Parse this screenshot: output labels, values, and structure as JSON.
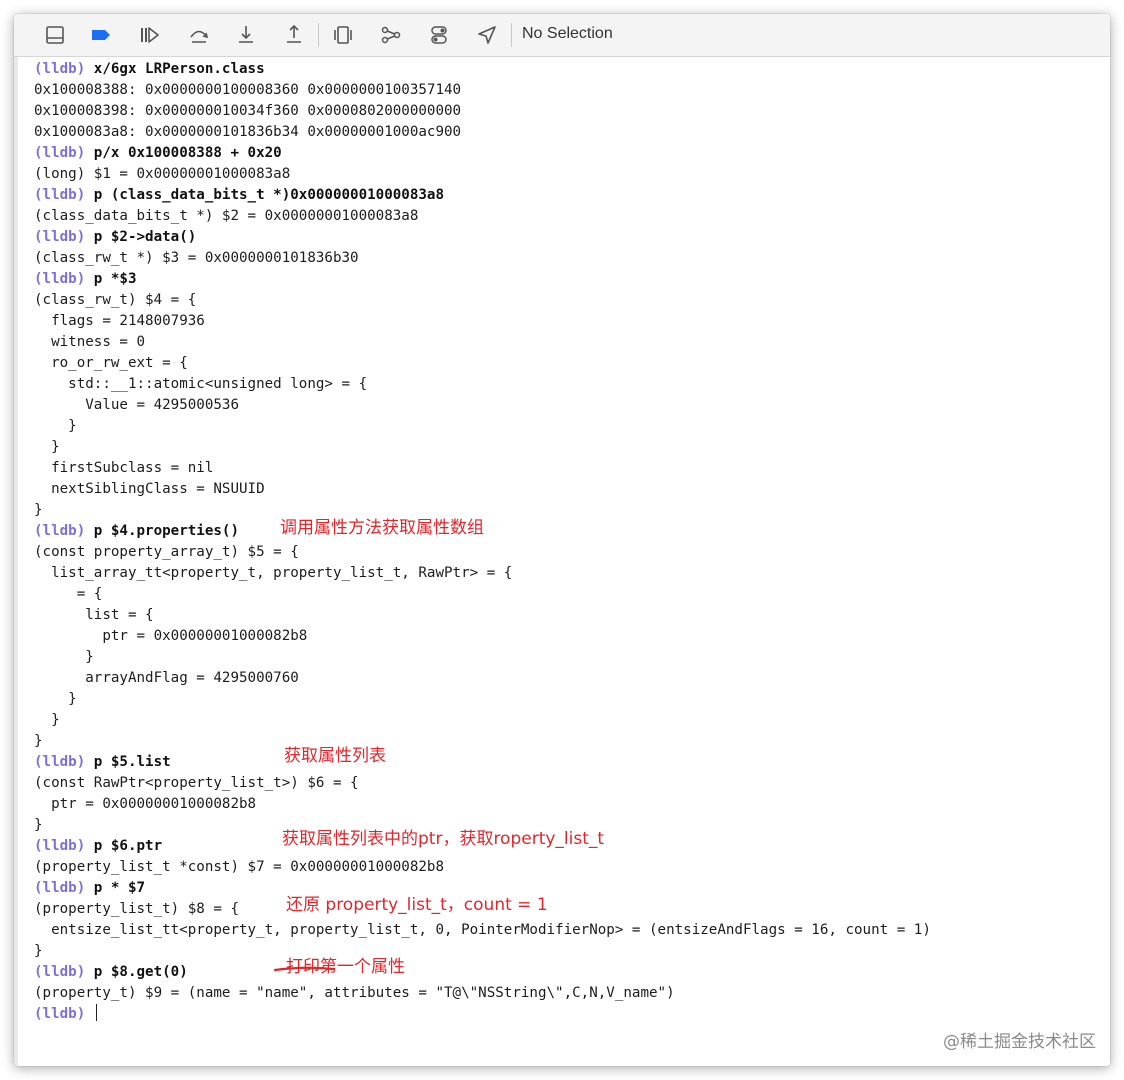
{
  "toolbar": {
    "status": "No Selection",
    "icons": [
      "hide-debug-area-icon",
      "breakpoints-toggle-icon",
      "continue-icon",
      "step-over-icon",
      "step-into-icon",
      "step-out-icon",
      "view-hierarchy-icon",
      "memory-graph-icon",
      "environment-overrides-icon",
      "simulate-location-icon"
    ]
  },
  "colors": {
    "prompt": "#7c70d6",
    "annotation": "#e0262b",
    "breakpoint_icon": "#1c6ef2"
  },
  "console": {
    "prompt": "(lldb)",
    "lines": [
      {
        "type": "cmd",
        "text": "x/6gx LRPerson.class"
      },
      {
        "type": "out",
        "text": "0x100008388: 0x0000000100008360 0x0000000100357140"
      },
      {
        "type": "out",
        "text": "0x100008398: 0x000000010034f360 0x0000802000000000"
      },
      {
        "type": "out",
        "text": "0x1000083a8: 0x0000000101836b34 0x00000001000ac900"
      },
      {
        "type": "cmd",
        "text": "p/x 0x100008388 + 0x20"
      },
      {
        "type": "out",
        "text": "(long) $1 = 0x00000001000083a8"
      },
      {
        "type": "cmd",
        "text": "p (class_data_bits_t *)0x00000001000083a8"
      },
      {
        "type": "out",
        "text": "(class_data_bits_t *) $2 = 0x00000001000083a8"
      },
      {
        "type": "cmd",
        "text": "p $2->data()"
      },
      {
        "type": "out",
        "text": "(class_rw_t *) $3 = 0x0000000101836b30"
      },
      {
        "type": "cmd",
        "text": "p *$3"
      },
      {
        "type": "out",
        "text": "(class_rw_t) $4 = {"
      },
      {
        "type": "out",
        "text": "  flags = 2148007936"
      },
      {
        "type": "out",
        "text": "  witness = 0"
      },
      {
        "type": "out",
        "text": "  ro_or_rw_ext = {"
      },
      {
        "type": "out",
        "text": "    std::__1::atomic<unsigned long> = {"
      },
      {
        "type": "out",
        "text": "      Value = 4295000536"
      },
      {
        "type": "out",
        "text": "    }"
      },
      {
        "type": "out",
        "text": "  }"
      },
      {
        "type": "out",
        "text": "  firstSubclass = nil"
      },
      {
        "type": "out",
        "text": "  nextSiblingClass = NSUUID"
      },
      {
        "type": "out",
        "text": "}"
      },
      {
        "type": "cmd",
        "text": "p $4.properties()"
      },
      {
        "type": "out",
        "text": "(const property_array_t) $5 = {"
      },
      {
        "type": "out",
        "text": "  list_array_tt<property_t, property_list_t, RawPtr> = {"
      },
      {
        "type": "out",
        "text": "     = {"
      },
      {
        "type": "out",
        "text": "      list = {"
      },
      {
        "type": "out",
        "text": "        ptr = 0x00000001000082b8"
      },
      {
        "type": "out",
        "text": "      }"
      },
      {
        "type": "out",
        "text": "      arrayAndFlag = 4295000760"
      },
      {
        "type": "out",
        "text": "    }"
      },
      {
        "type": "out",
        "text": "  }"
      },
      {
        "type": "out",
        "text": "}"
      },
      {
        "type": "cmd",
        "text": "p $5.list"
      },
      {
        "type": "out",
        "text": "(const RawPtr<property_list_t>) $6 = {"
      },
      {
        "type": "out",
        "text": "  ptr = 0x00000001000082b8"
      },
      {
        "type": "out",
        "text": "}"
      },
      {
        "type": "cmd",
        "text": "p $6.ptr"
      },
      {
        "type": "out",
        "text": "(property_list_t *const) $7 = 0x00000001000082b8"
      },
      {
        "type": "cmd",
        "text": "p * $7"
      },
      {
        "type": "out",
        "text": "(property_list_t) $8 = {"
      },
      {
        "type": "out",
        "text": "  entsize_list_tt<property_t, property_list_t, 0, PointerModifierNop> = (entsizeAndFlags = 16, count = 1)"
      },
      {
        "type": "out",
        "text": "}"
      },
      {
        "type": "cmd",
        "text": "p $8.get(0)"
      },
      {
        "type": "out",
        "text": "(property_t) $9 = (name = \"name\", attributes = \"T@\\\"NSString\\\",C,N,V_name\")"
      },
      {
        "type": "cursor",
        "text": ""
      }
    ]
  },
  "annotations": [
    {
      "line": 22,
      "text": "调用属性方法获取属性数组"
    },
    {
      "line": 33,
      "text": "获取属性列表"
    },
    {
      "line": 37,
      "text": "获取属性列表中的ptr，获取roperty_list_t"
    },
    {
      "line": 40,
      "text": "还原 property_list_t，count = 1"
    },
    {
      "line": 43,
      "text": "打印第一个属性"
    }
  ],
  "watermark": "@稀土掘金技术社区"
}
